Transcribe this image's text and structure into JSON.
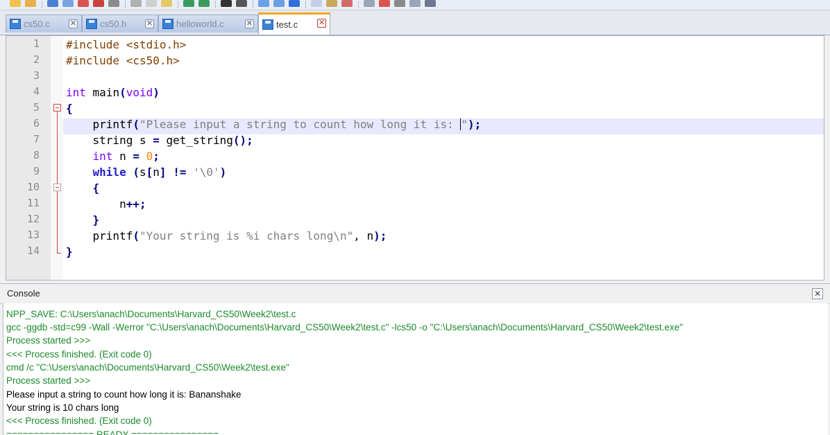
{
  "colors": {
    "tab_active_border": "#f5a623",
    "keyword": "#1f1fcf",
    "type": "#8000ff",
    "preprocessor": "#804000",
    "string": "#808080",
    "number": "#ff8000",
    "console_green": "#1a8a2a",
    "current_line": "#e8e8ff",
    "fold_marker": "#d04040"
  },
  "toolbar": {
    "icons": [
      "new-file-icon",
      "open-file-icon",
      "save-icon",
      "save-all-icon",
      "close-icon",
      "close-all-icon",
      "print-icon",
      "cut-icon",
      "copy-icon",
      "paste-icon",
      "undo-icon",
      "redo-icon",
      "find-icon",
      "replace-icon",
      "zoom-in-icon",
      "zoom-out-icon",
      "sync-icon",
      "wrap-icon",
      "indent-icon",
      "bookmark-icon",
      "run-icon",
      "record-macro-icon",
      "stop-macro-icon",
      "play-macro-icon",
      "macro-list-icon"
    ]
  },
  "tabs": [
    {
      "label": "cs50.c",
      "close": "✕",
      "active": false
    },
    {
      "label": "cs50.h",
      "close": "✕",
      "active": false
    },
    {
      "label": "helloworld.c",
      "close": "✕",
      "active": false
    },
    {
      "label": "test.c",
      "close": "✕",
      "active": true
    }
  ],
  "editor": {
    "line_numbers": [
      "1",
      "2",
      "3",
      "4",
      "5",
      "6",
      "7",
      "8",
      "9",
      "10",
      "11",
      "12",
      "13",
      "14"
    ],
    "lines": [
      {
        "text": "#include <stdio.h>"
      },
      {
        "text": "#include <cs50.h>"
      },
      {
        "text": ""
      },
      {
        "text": "int main(void)"
      },
      {
        "text": "{"
      },
      {
        "text": "    printf(\"Please input a string to count how long it is: \");"
      },
      {
        "text": "    string s = get_string();"
      },
      {
        "text": "    int n = 0;"
      },
      {
        "text": "    while (s[n] != '\\0')"
      },
      {
        "text": "    {"
      },
      {
        "text": "        n++;"
      },
      {
        "text": "    }"
      },
      {
        "text": "    printf(\"Your string is %i chars long\\n\", n);"
      },
      {
        "text": "}"
      }
    ],
    "current_line": 6
  },
  "console": {
    "title": "Console",
    "close": "✕",
    "lines": [
      {
        "text": "NPP_SAVE: C:\\Users\\anach\\Documents\\Harvard_CS50\\Week2\\test.c",
        "color": "green"
      },
      {
        "text": "gcc -ggdb -std=c99 -Wall -Werror \"C:\\Users\\anach\\Documents\\Harvard_CS50\\Week2\\test.c\" -lcs50 -o \"C:\\Users\\anach\\Documents\\Harvard_CS50\\Week2\\test.exe\"",
        "color": "green"
      },
      {
        "text": "Process started >>>",
        "color": "green"
      },
      {
        "text": "<<< Process finished. (Exit code 0)",
        "color": "green"
      },
      {
        "text": "cmd /c \"C:\\Users\\anach\\Documents\\Harvard_CS50\\Week2\\test.exe\"",
        "color": "green"
      },
      {
        "text": "Process started >>>",
        "color": "green"
      },
      {
        "text": "Please input a string to count how long it is: Bananshake",
        "color": "black"
      },
      {
        "text": "Your string is 10 chars long",
        "color": "black"
      },
      {
        "text": "<<< Process finished. (Exit code 0)",
        "color": "green"
      },
      {
        "text": "================ READY ================",
        "color": "green"
      }
    ]
  }
}
